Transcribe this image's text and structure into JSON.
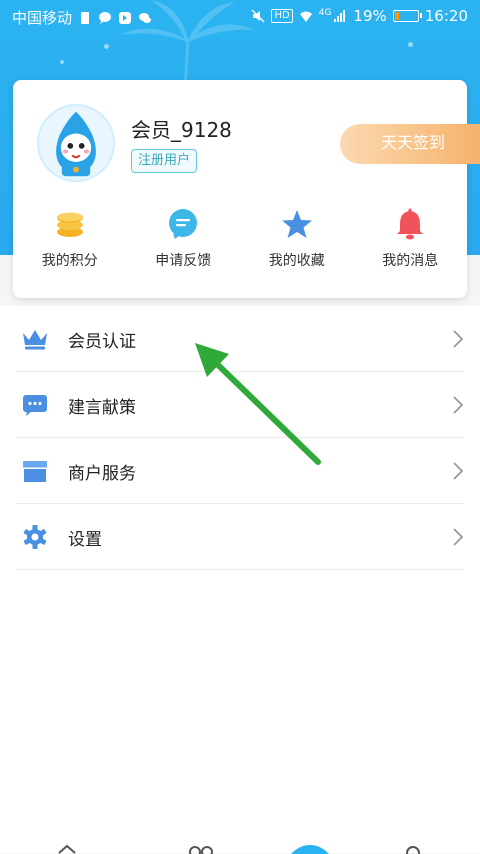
{
  "status_bar": {
    "carrier": "中国移动",
    "network": "4G",
    "hd_label": "HD",
    "battery": "19%",
    "time": "16:20",
    "icons": [
      "sim-icon",
      "chat-bubble-icon",
      "shield-icon",
      "wechat-icon",
      "mute-icon",
      "wifi-icon",
      "signal-icon",
      "battery-icon"
    ]
  },
  "profile": {
    "username": "会员_9128",
    "badge": "注册用户",
    "checkin_label": "天天签到",
    "avatar_icon": "mascot-avatar"
  },
  "quick_actions": [
    {
      "label": "我的积分",
      "icon": "coins-icon",
      "color": "#f5b324"
    },
    {
      "label": "申请反馈",
      "icon": "feedback-icon",
      "color": "#3db6e8"
    },
    {
      "label": "我的收藏",
      "icon": "star-icon",
      "color": "#4a90e2"
    },
    {
      "label": "我的消息",
      "icon": "bell-icon",
      "color": "#f0545a"
    }
  ],
  "menu": [
    {
      "label": "会员认证",
      "icon": "crown-icon"
    },
    {
      "label": "建言献策",
      "icon": "message-icon"
    },
    {
      "label": "商户服务",
      "icon": "store-icon"
    },
    {
      "label": "设置",
      "icon": "gear-icon"
    }
  ],
  "colors": {
    "header": "#2bb3f1",
    "accent": "#4a8fe2",
    "arrow": "#2faa3a"
  }
}
